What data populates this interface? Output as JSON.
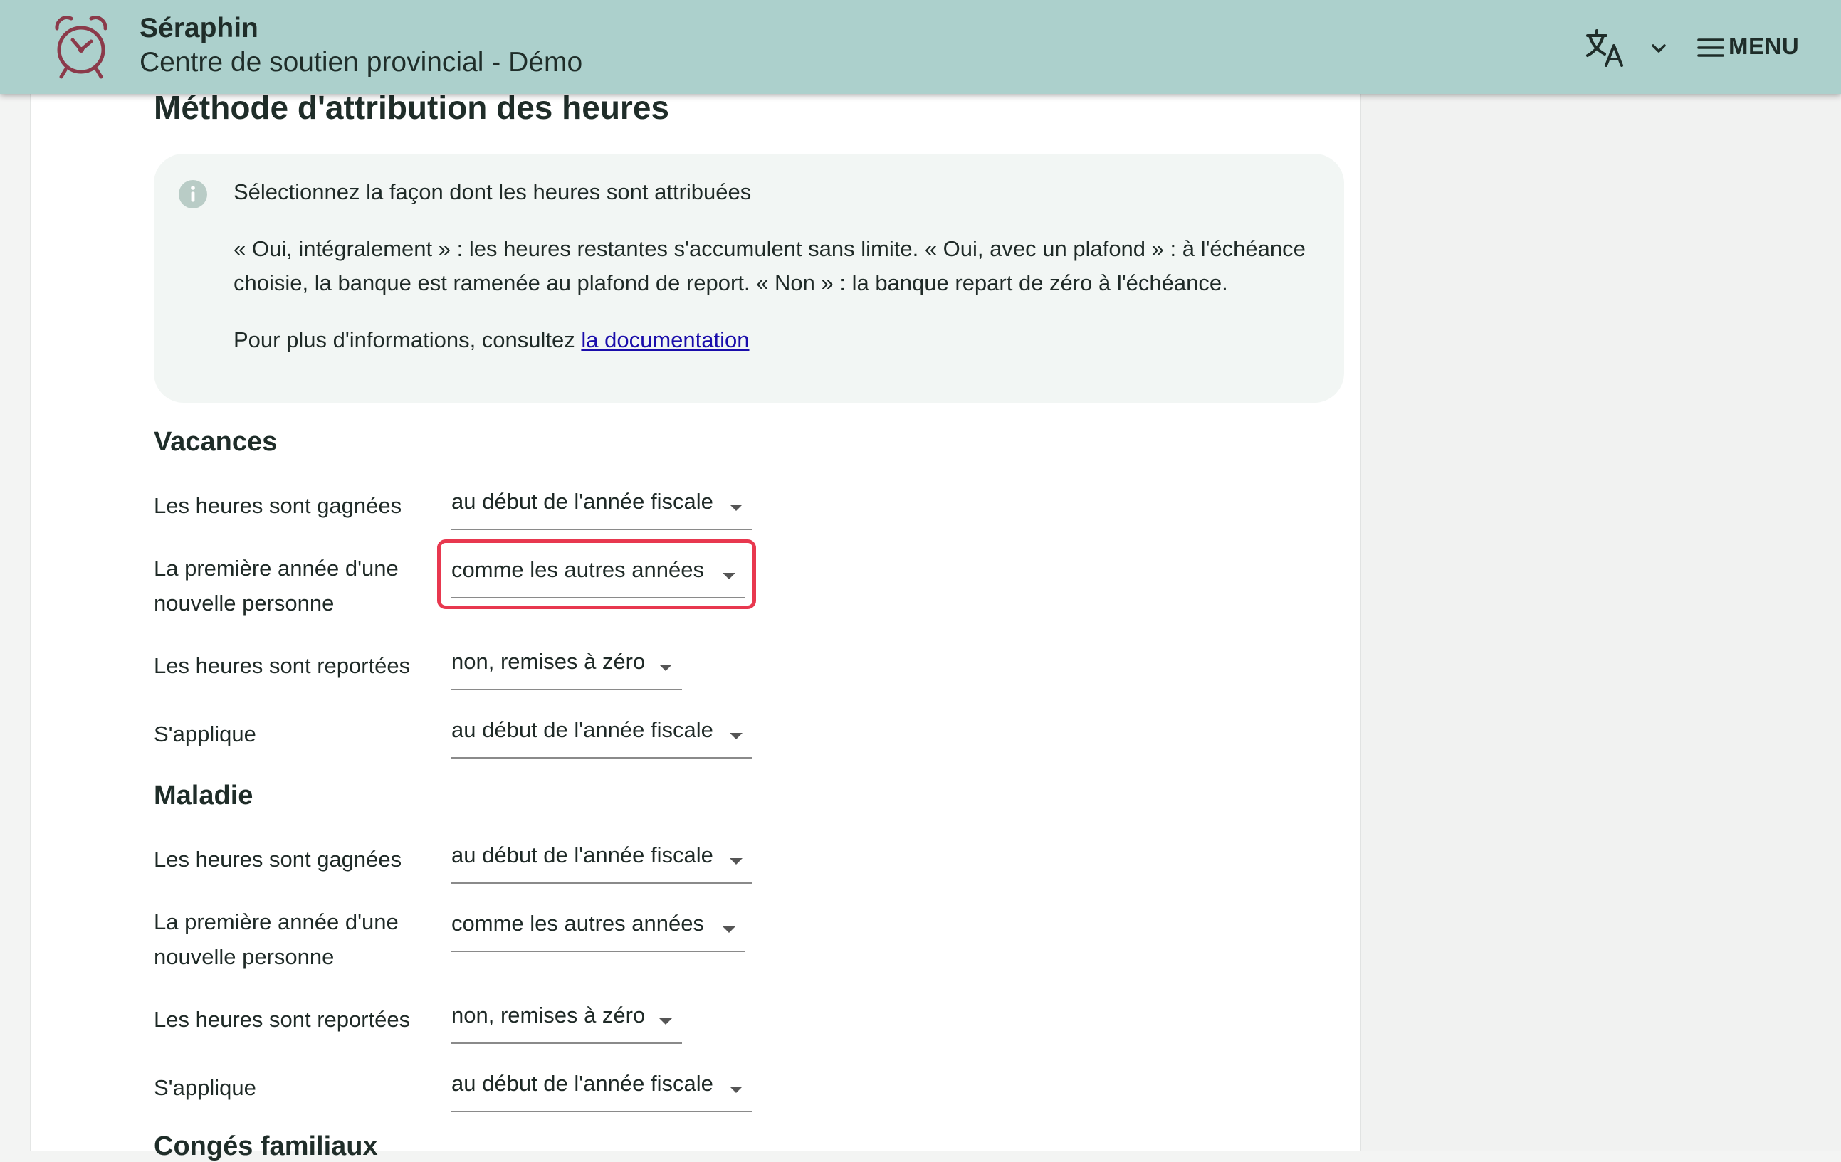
{
  "header": {
    "app_name": "Séraphin",
    "organization": "Centre de soutien provincial - Démo",
    "menu_label": "MENU",
    "logo_icon": "alarm-clock-icon",
    "language_icon": "translate-icon",
    "colors": {
      "appbar": "#acd0cc",
      "logo": "#8b3a4a",
      "highlight": "#e8384f"
    }
  },
  "page": {
    "section_title": "Méthode d'attribution des heures",
    "info": {
      "heading": "Sélectionnez la façon dont les heures sont attribuées",
      "description": "« Oui, intégralement » : les heures restantes s'accumulent sans limite. « Oui, avec un plafond » : à l'échéance choisie, la banque est ramenée au plafond de report. « Non » : la banque repart de zéro à l'échéance.",
      "more_prefix": "Pour plus d'informations, consultez ",
      "more_link": "la documentation"
    },
    "groups": [
      {
        "title": "Vacances",
        "rows": [
          {
            "label": "Les heures sont gagnées",
            "value": "au début de l'année fiscale"
          },
          {
            "label": "La première année d'une nouvelle personne",
            "value": "comme les autres années",
            "highlighted": true
          },
          {
            "label": "Les heures sont reportées",
            "value": "non, remises à zéro"
          },
          {
            "label": "S'applique",
            "value": "au début de l'année fiscale"
          }
        ]
      },
      {
        "title": "Maladie",
        "rows": [
          {
            "label": "Les heures sont gagnées",
            "value": "au début de l'année fiscale"
          },
          {
            "label": "La première année d'une nouvelle personne",
            "value": "comme les autres années"
          },
          {
            "label": "Les heures sont reportées",
            "value": "non, remises à zéro"
          },
          {
            "label": "S'applique",
            "value": "au début de l'année fiscale"
          }
        ]
      },
      {
        "title": "Congés familiaux"
      }
    ]
  }
}
